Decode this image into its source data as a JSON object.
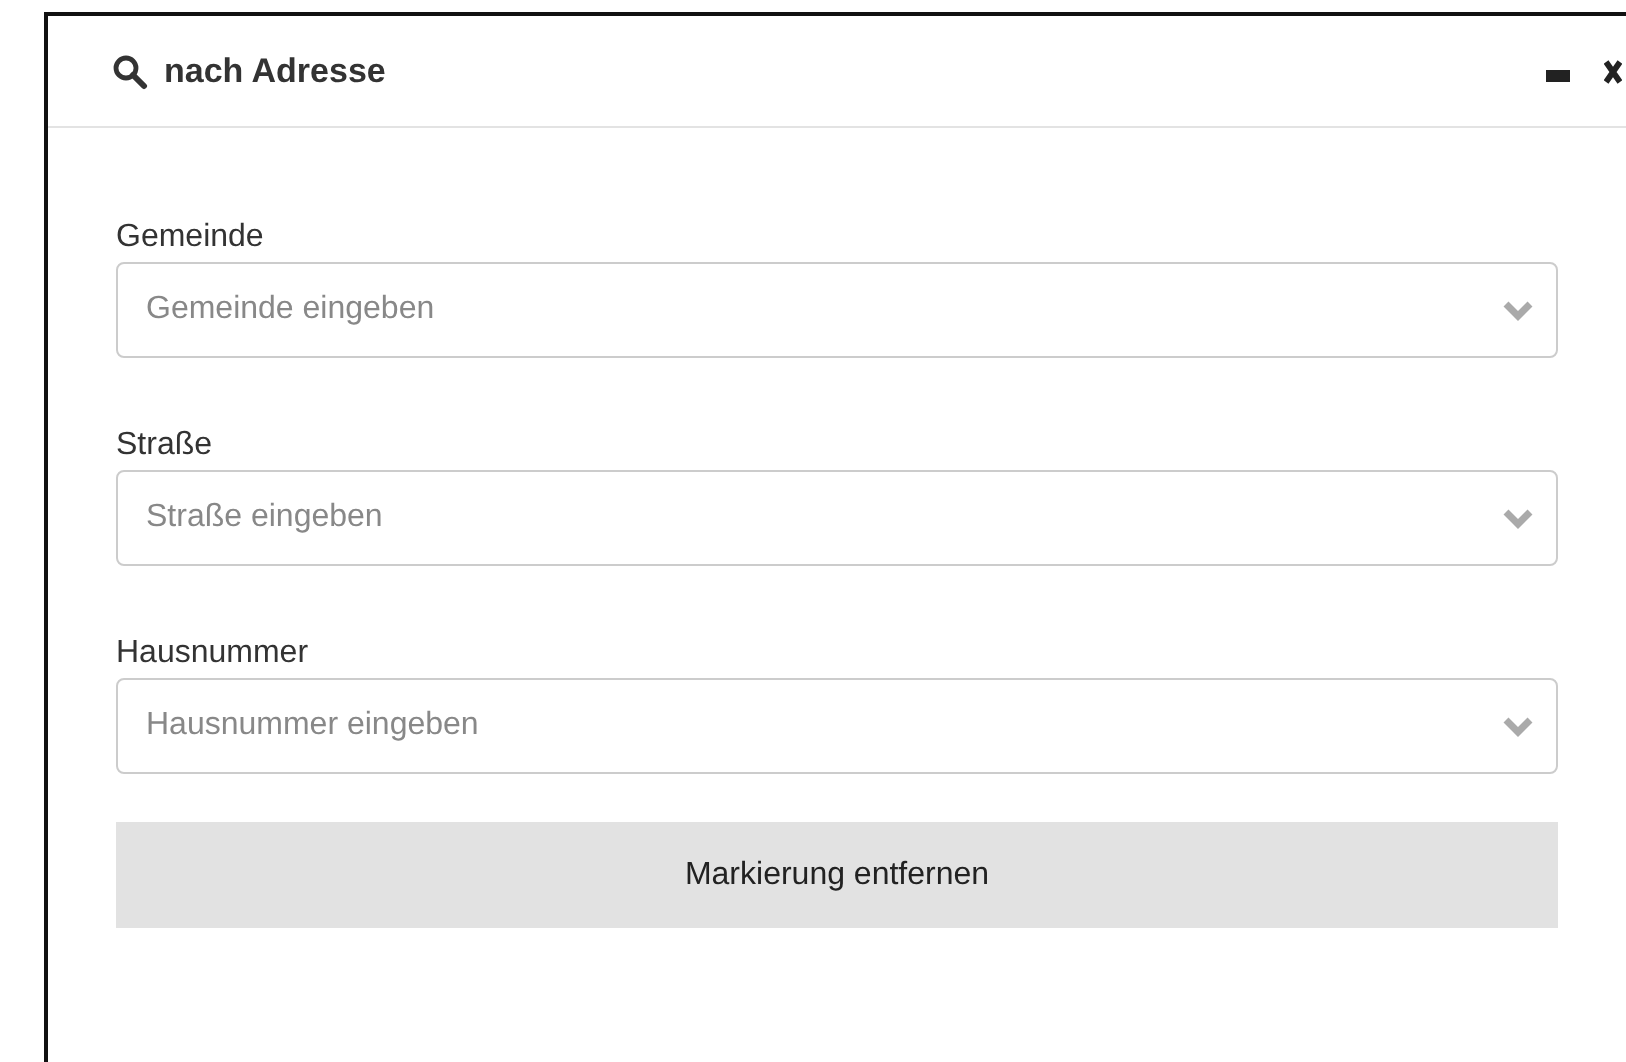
{
  "panel": {
    "title": "nach Adresse"
  },
  "fields": [
    {
      "label": "Gemeinde",
      "placeholder": "Gemeinde eingeben"
    },
    {
      "label": "Straße",
      "placeholder": "Straße eingeben"
    },
    {
      "label": "Hausnummer",
      "placeholder": "Hausnummer eingeben"
    }
  ],
  "button": "Markierung entfernen"
}
